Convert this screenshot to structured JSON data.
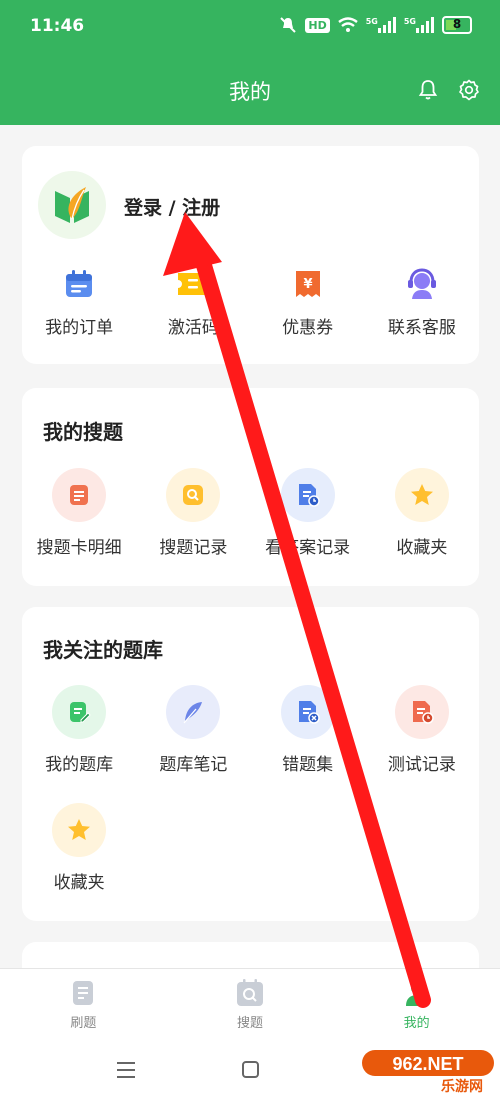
{
  "status": {
    "time": "11:46",
    "hd": "HD",
    "net1": "5G",
    "net2": "5G",
    "battery": "8"
  },
  "header": {
    "title": "我的"
  },
  "profile": {
    "login_label": "登录 / 注册"
  },
  "quick_actions": [
    {
      "label": "我的订单",
      "icon": "calendar-icon"
    },
    {
      "label": "激活码",
      "icon": "ticket-icon"
    },
    {
      "label": "优惠券",
      "icon": "coupon-icon"
    },
    {
      "label": "联系客服",
      "icon": "headset-icon"
    }
  ],
  "my_search": {
    "title": "我的搜题",
    "items": [
      {
        "label": "搜题卡明细",
        "icon": "list-icon"
      },
      {
        "label": "搜题记录",
        "icon": "search-icon"
      },
      {
        "label": "看答案记录",
        "icon": "doc-clock-icon"
      },
      {
        "label": "收藏夹",
        "icon": "star-icon"
      }
    ]
  },
  "followed_banks": {
    "title": "我关注的题库",
    "items": [
      {
        "label": "我的题库",
        "icon": "edit-doc-icon"
      },
      {
        "label": "题库笔记",
        "icon": "feather-icon"
      },
      {
        "label": "错题集",
        "icon": "doc-x-icon"
      },
      {
        "label": "测试记录",
        "icon": "doc-clock-icon"
      },
      {
        "label": "收藏夹",
        "icon": "star-icon"
      }
    ]
  },
  "bottom_nav": [
    {
      "label": "刷题",
      "icon": "doc-icon"
    },
    {
      "label": "搜题",
      "icon": "search-calendar-icon"
    },
    {
      "label": "我的",
      "icon": "user-icon"
    }
  ],
  "watermark": {
    "brand": "962.NET",
    "sub": "乐游网"
  },
  "colors": {
    "primary": "#36b45f",
    "arrow": "#ff1a1a"
  }
}
